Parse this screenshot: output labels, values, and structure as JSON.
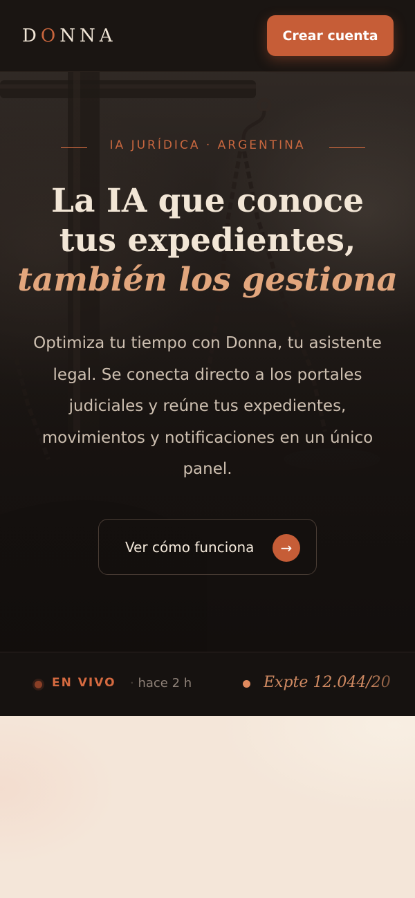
{
  "brand": {
    "logo_text": "DONNA",
    "logo_prefix": "D",
    "logo_accent": "O",
    "logo_suffix": "NNA",
    "accent_color": "#c65d37"
  },
  "header": {
    "cta_label": "Crear cuenta"
  },
  "hero": {
    "eyebrow": "IA JURÍDICA · ARGENTINA",
    "headline_line1": "La IA que conoce",
    "headline_line2": "tus expedientes,",
    "headline_line3": "también los gestiona",
    "subtext": "Optimiza tu tiempo con Donna, tu asistente legal. Se conecta directo a los portales judiciales y reúne tus expedientes, movimientos y notificaciones en un único panel.",
    "secondary_cta_label": "Ver cómo funciona",
    "secondary_cta_icon": "arrow-right-icon",
    "secondary_cta_glyph": "→"
  },
  "ticker": {
    "live_label": "EN VIVO",
    "item_prefix": "·",
    "item_time": "hace 2 h",
    "item_case": "Expte 12.044/20"
  }
}
